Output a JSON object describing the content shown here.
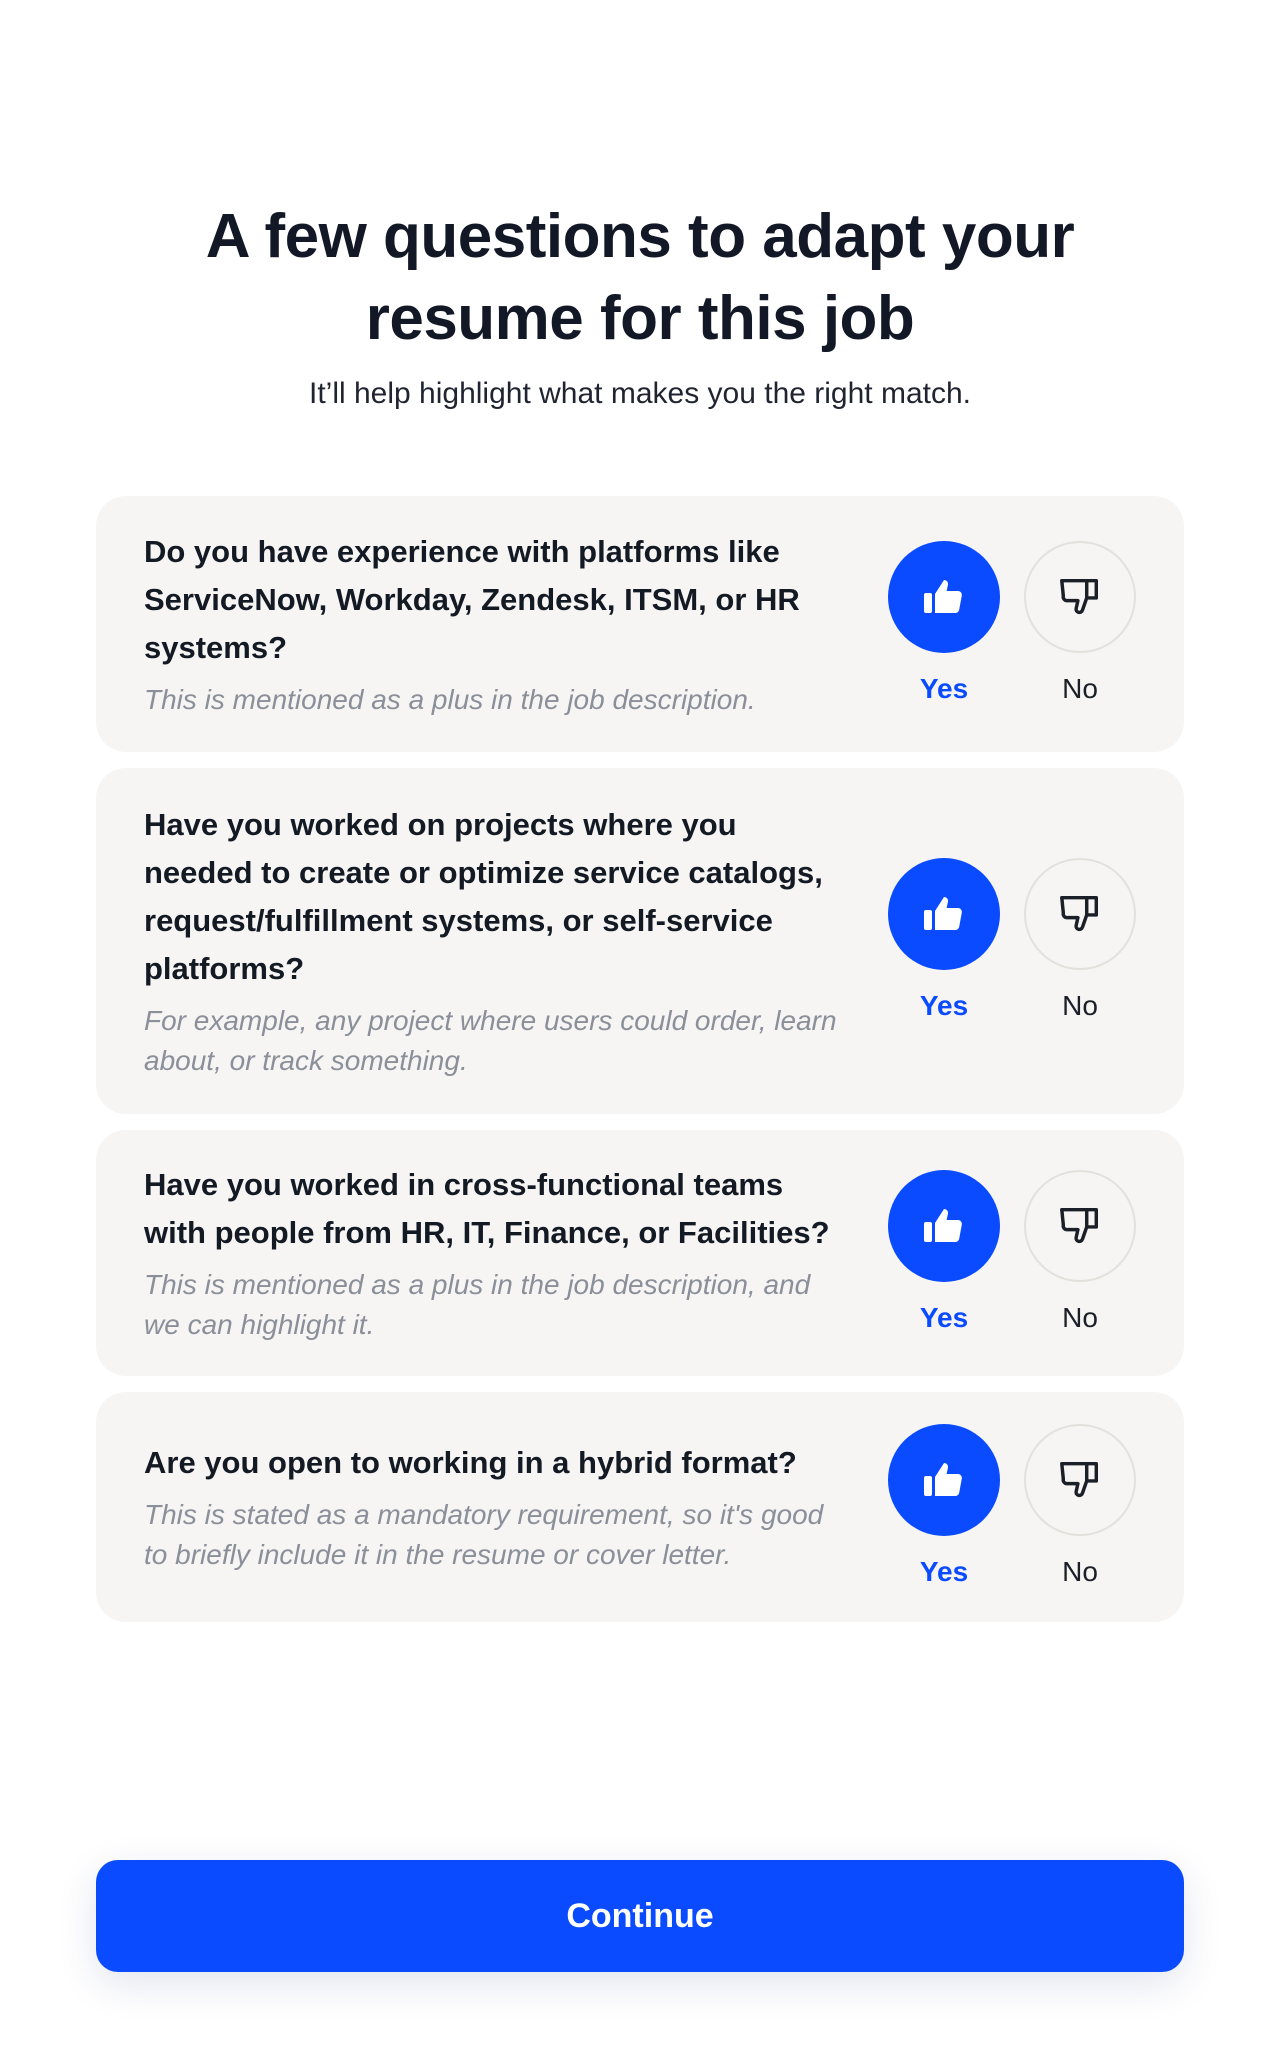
{
  "header": {
    "title": "A few questions to adapt your resume for this job",
    "subtitle": "It’ll help highlight what makes you the right match."
  },
  "questions": [
    {
      "question": "Do you have experience with platforms like ServiceNow, Workday, Zendesk, ITSM, or HR systems?",
      "hint": "This is mentioned as a plus in the job description.",
      "yes_label": "Yes",
      "no_label": "No",
      "selected": "yes"
    },
    {
      "question": "Have you worked on projects where you needed to create or optimize service catalogs, request/fulfillment systems, or self-service platforms?",
      "hint": "For example, any project where users could order, learn about, or track something.",
      "yes_label": "Yes",
      "no_label": "No",
      "selected": "yes"
    },
    {
      "question": "Have you worked in cross-functional teams with people from HR, IT, Finance, or Facilities?",
      "hint": "This is mentioned as a plus in the job description, and we can highlight it.",
      "yes_label": "Yes",
      "no_label": "No",
      "selected": "yes"
    },
    {
      "question": "Are you open to working in a hybrid format?",
      "hint": "This is stated as a mandatory requirement, so it's good to briefly include it in the resume or cover letter.",
      "yes_label": "Yes",
      "no_label": "No",
      "selected": "yes"
    }
  ],
  "icons": {
    "yes": "thumbs-up-icon",
    "no": "thumbs-down-icon"
  },
  "colors": {
    "accent": "#0a4bff",
    "card_bg": "#f6f5f3",
    "hint": "#8a8f99"
  },
  "footer": {
    "continue_label": "Continue"
  }
}
